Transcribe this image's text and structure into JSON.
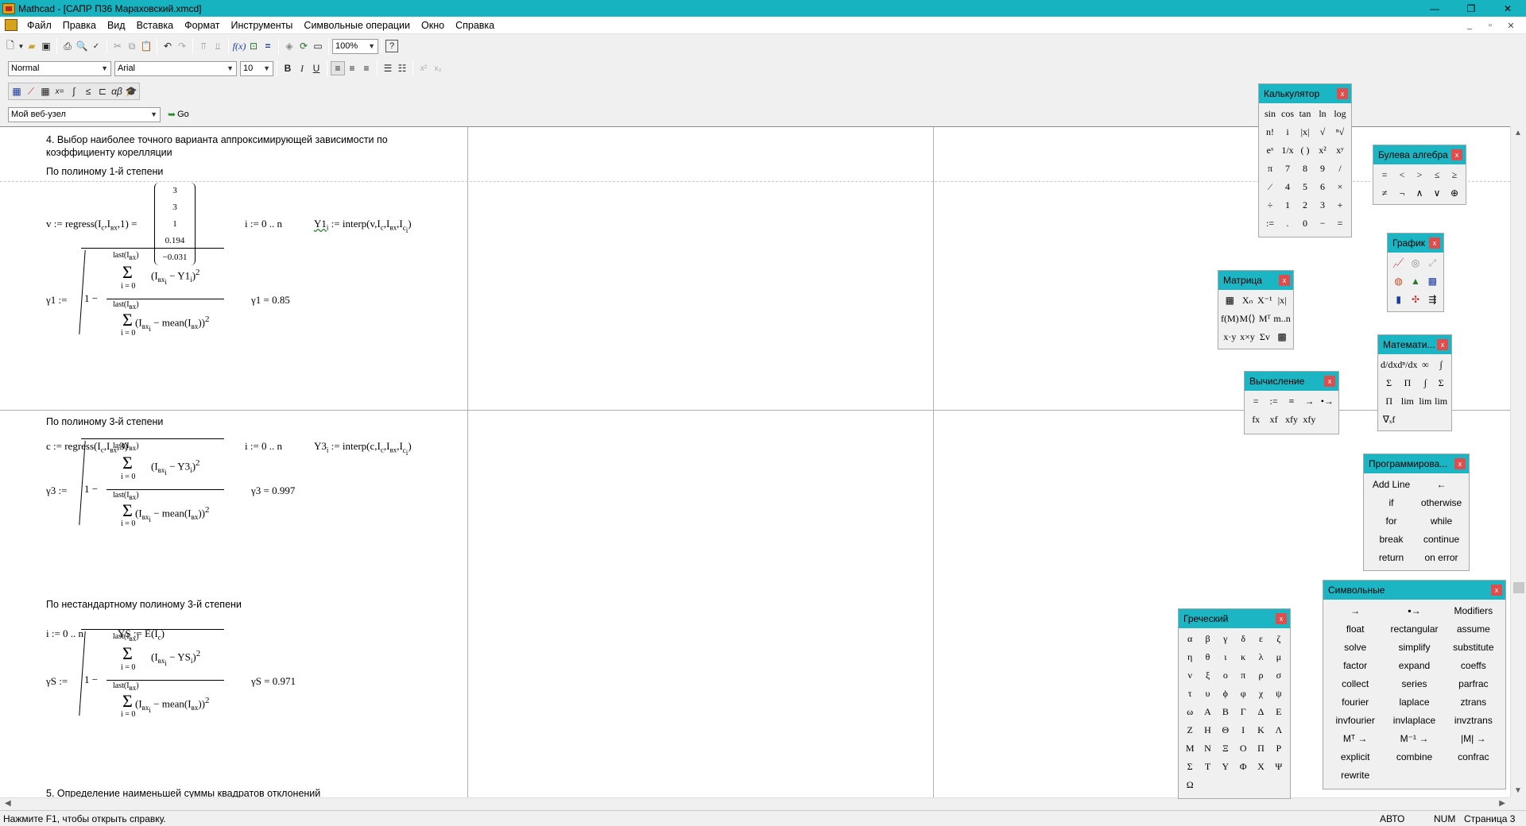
{
  "window": {
    "title": "Mathcad - [САПР П36 Мараховский.xmcd]",
    "controls": [
      "—",
      "❐",
      "✕"
    ],
    "mdi": [
      "_",
      "▫",
      "✕"
    ]
  },
  "menu": [
    "Файл",
    "Правка",
    "Вид",
    "Вставка",
    "Формат",
    "Инструменты",
    "Символьные операции",
    "Окно",
    "Справка"
  ],
  "toolbar": {
    "zoom": "100%",
    "style": "Normal",
    "font": "Arial",
    "size": "10",
    "bold": "B",
    "italic": "I",
    "underline": "U",
    "website": "Мой веб-узел",
    "go": "Go"
  },
  "document": {
    "h4": "4. Выбор наиболее точного варианта аппроксимирующей зависимости по коэффициенту корелляции",
    "p1": "По полиному 1-й степени",
    "p3": "По полиному 3-й степени",
    "pn": "По нестандартному полиному 3-й степени",
    "h5": "5. Определение наименьшей суммы квадратов отклонений",
    "v_lhs": "v := regress(I",
    "vec": [
      "3",
      "3",
      "1",
      "0.194",
      "−0.031"
    ],
    "range": "i := 0 .. n",
    "y1": "Y1",
    "interp": ":= interp",
    "gamma1_lhs": "γ1 :=",
    "gamma1_res": "γ1 = 0.85",
    "c_lhs": "c := regress(I",
    "y3": "Y3",
    "gamma3_lhs": "γ3 :=",
    "gamma3_res": "γ3 = 0.997",
    "ys": "YS := E(I",
    "gammas_lhs": "γS :=",
    "gammas_res": "γS = 0.971",
    "last": "last(I",
    "isub": "i = 0",
    "mean": "mean(I"
  },
  "palettes": {
    "calc": {
      "title": "Калькулятор",
      "keys": [
        "sin",
        "cos",
        "tan",
        "ln",
        "log",
        "n!",
        "i",
        "|x|",
        "√",
        "ⁿ√",
        "eˣ",
        "1/x",
        "( )",
        "x²",
        "xʸ",
        "π",
        "7",
        "8",
        "9",
        "/",
        "⁄",
        "4",
        "5",
        "6",
        "×",
        "÷",
        "1",
        "2",
        "3",
        "+",
        ":=",
        ".",
        "0",
        "−",
        "="
      ]
    },
    "bool": {
      "title": "Булева алгебра",
      "keys": [
        "=",
        "<",
        ">",
        "≤",
        "≥",
        "≠",
        "¬",
        "∧",
        "∨",
        "⊕"
      ]
    },
    "graph": {
      "title": "График"
    },
    "matrix": {
      "title": "Матрица"
    },
    "eval": {
      "title": "Вычисление",
      "keys": [
        "=",
        ":=",
        "≡",
        "→",
        "•→",
        "fx",
        "xf",
        "xfy",
        "xfy"
      ]
    },
    "mathcalc": {
      "title": "Математи...",
      "keys": [
        "d/dx",
        "dⁿ/dx",
        "∞",
        "∫",
        "Σ",
        "Π",
        "∫",
        "Σ",
        "Π",
        "lim",
        "lim",
        "lim",
        "∇ₓf"
      ]
    },
    "prog": {
      "title": "Программирова...",
      "keys": [
        "Add Line",
        "←",
        "if",
        "otherwise",
        "for",
        "while",
        "break",
        "continue",
        "return",
        "on error"
      ]
    },
    "greek": {
      "title": "Греческий",
      "keys": [
        "α",
        "β",
        "γ",
        "δ",
        "ε",
        "ζ",
        "η",
        "θ",
        "ι",
        "κ",
        "λ",
        "μ",
        "ν",
        "ξ",
        "ο",
        "π",
        "ρ",
        "σ",
        "τ",
        "υ",
        "ϕ",
        "φ",
        "χ",
        "ψ",
        "ω",
        "Α",
        "Β",
        "Γ",
        "Δ",
        "Ε",
        "Ζ",
        "Η",
        "Θ",
        "Ι",
        "Κ",
        "Λ",
        "Μ",
        "Ν",
        "Ξ",
        "Ο",
        "Π",
        "Ρ",
        "Σ",
        "Τ",
        "Υ",
        "Φ",
        "Χ",
        "Ψ",
        "Ω"
      ]
    },
    "sym": {
      "title": "Символьные",
      "keys": [
        "→",
        "▪→",
        "Modifiers",
        "float",
        "rectangular",
        "assume",
        "solve",
        "simplify",
        "substitute",
        "factor",
        "expand",
        "coeffs",
        "collect",
        "series",
        "parfrac",
        "fourier",
        "laplace",
        "ztrans",
        "invfourier",
        "invlaplace",
        "invztrans",
        "Mᵀ →",
        "M⁻¹ →",
        "|M| →",
        "explicit",
        "combine",
        "confrac",
        "rewrite"
      ]
    }
  },
  "status": {
    "hint": "Нажмите F1, чтобы открыть справку.",
    "auto": "АВТО",
    "num": "NUM",
    "page": "Страница 3"
  }
}
